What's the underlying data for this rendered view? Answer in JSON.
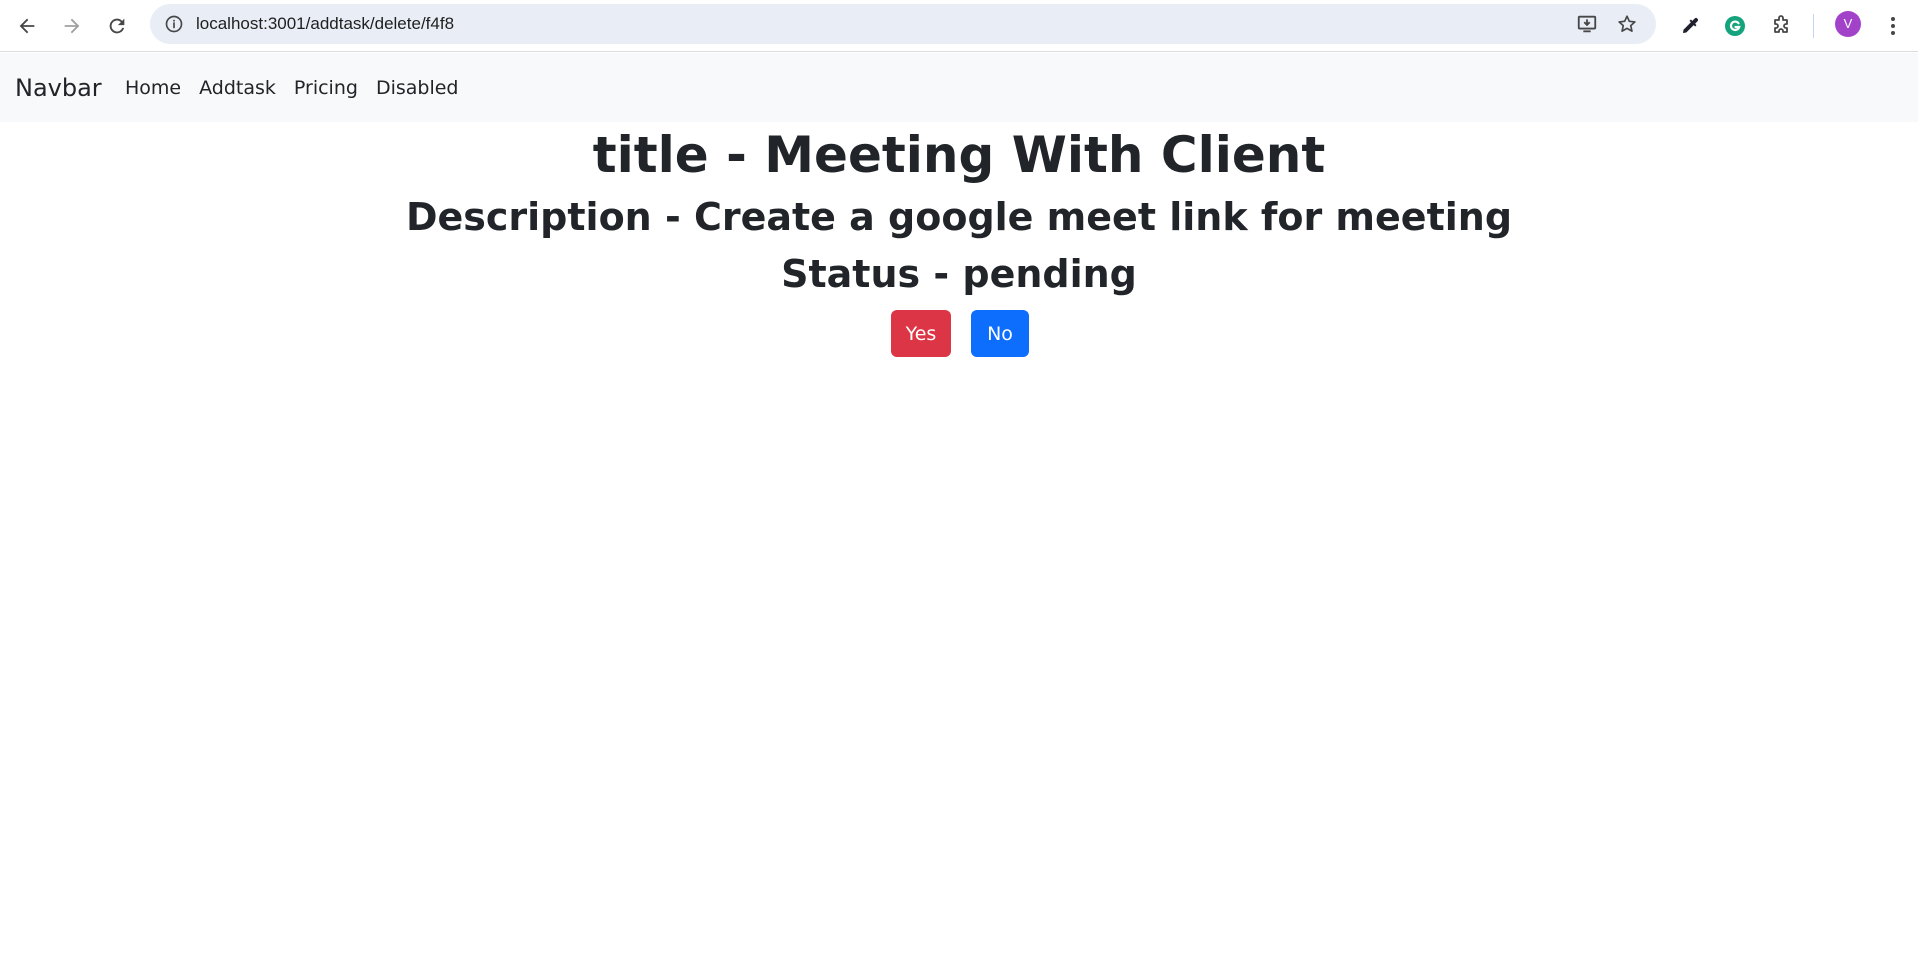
{
  "browser": {
    "url": "localhost:3001/addtask/delete/f4f8",
    "profile_initial": "V"
  },
  "navbar": {
    "brand": "Navbar",
    "links": [
      {
        "label": "Home"
      },
      {
        "label": "Addtask"
      },
      {
        "label": "Pricing"
      },
      {
        "label": "Disabled"
      }
    ]
  },
  "task": {
    "title": "title - Meeting With Client",
    "description": "Description - Create a google meet link for meeting",
    "status": "Status - pending"
  },
  "actions": {
    "yes_label": "Yes",
    "no_label": "No",
    "yes_color": "#dc3545",
    "no_color": "#0d6efd"
  },
  "colors": {
    "text": "#212529",
    "navbar_bg": "#f8f9fa",
    "omnibox_bg": "#e9eef6",
    "avatar_bg": "#a142c9"
  }
}
